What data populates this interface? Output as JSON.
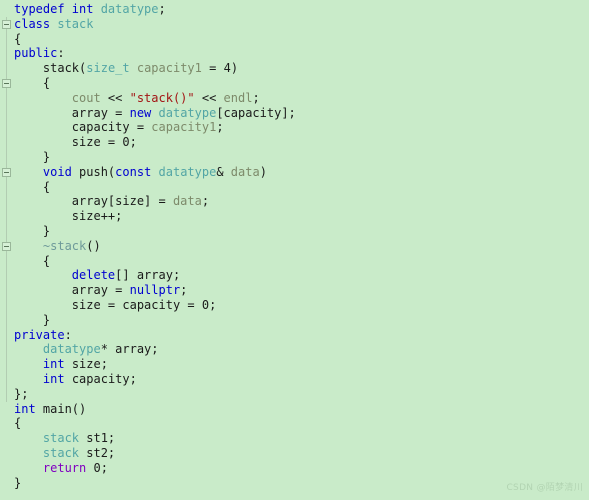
{
  "editor": {
    "background_color": "#c9ebc9",
    "language": "C++",
    "colors": {
      "keyword": "#0000d0",
      "type": "#52a5a5",
      "string": "#a31515",
      "variable": "#7d8a6a",
      "return_keyword": "#8000c0",
      "plain": "#1a1a1a",
      "destructor": "#6f9a9a",
      "gutter_rail": "#b2cdb2",
      "watermark": "#b2d4b2"
    }
  },
  "watermark": {
    "text": "CSDN @陌梦清川"
  },
  "gutter": {
    "fold_markers": [
      {
        "line": 2,
        "label": "fold-class-stack"
      },
      {
        "line": 6,
        "label": "fold-constructor"
      },
      {
        "line": 12,
        "label": "fold-push"
      },
      {
        "line": 17,
        "label": "fold-destructor"
      }
    ]
  },
  "code": {
    "lines": [
      {
        "n": 1,
        "text": "typedef int datatype;"
      },
      {
        "n": 2,
        "text": "class stack"
      },
      {
        "n": 3,
        "text": "{"
      },
      {
        "n": 4,
        "text": "public:"
      },
      {
        "n": 5,
        "text": "    stack(size_t capacity1 = 4)"
      },
      {
        "n": 6,
        "text": "    {"
      },
      {
        "n": 7,
        "text": "        cout << \"stack()\" << endl;"
      },
      {
        "n": 8,
        "text": "        array = new datatype[capacity];"
      },
      {
        "n": 9,
        "text": "        capacity = capacity1;"
      },
      {
        "n": 10,
        "text": "        size = 0;"
      },
      {
        "n": 11,
        "text": "    }"
      },
      {
        "n": 12,
        "text": "    void push(const datatype& data)"
      },
      {
        "n": 13,
        "text": "    {"
      },
      {
        "n": 14,
        "text": "        array[size] = data;"
      },
      {
        "n": 15,
        "text": "        size++;"
      },
      {
        "n": 16,
        "text": "    }"
      },
      {
        "n": 17,
        "text": "    ~stack()"
      },
      {
        "n": 18,
        "text": "    {"
      },
      {
        "n": 19,
        "text": "        delete[] array;"
      },
      {
        "n": 20,
        "text": "        array = nullptr;"
      },
      {
        "n": 21,
        "text": "        size = capacity = 0;"
      },
      {
        "n": 22,
        "text": "    }"
      },
      {
        "n": 23,
        "text": "private:"
      },
      {
        "n": 24,
        "text": "    datatype* array;"
      },
      {
        "n": 25,
        "text": "    int size;"
      },
      {
        "n": 26,
        "text": "    int capacity;"
      },
      {
        "n": 27,
        "text": "};"
      },
      {
        "n": 28,
        "text": "int main()"
      },
      {
        "n": 29,
        "text": "{"
      },
      {
        "n": 30,
        "text": "    stack st1;"
      },
      {
        "n": 31,
        "text": "    stack st2;"
      },
      {
        "n": 32,
        "text": "    return 0;"
      },
      {
        "n": 33,
        "text": "}"
      }
    ],
    "tokens": [
      [
        {
          "t": "typedef ",
          "c": "kw"
        },
        {
          "t": "int ",
          "c": "kw"
        },
        {
          "t": "datatype",
          "c": "typ"
        },
        {
          "t": ";",
          "c": "pun"
        }
      ],
      [
        {
          "t": "class ",
          "c": "kw"
        },
        {
          "t": "stack",
          "c": "typ"
        }
      ],
      [
        {
          "t": "{",
          "c": "pun"
        }
      ],
      [
        {
          "t": "public",
          "c": "kw"
        },
        {
          "t": ":",
          "c": "pun"
        }
      ],
      [
        {
          "t": "    stack",
          "c": "pun"
        },
        {
          "t": "(",
          "c": "pun"
        },
        {
          "t": "size_t",
          "c": "typ"
        },
        {
          "t": " ",
          "c": "pun"
        },
        {
          "t": "capacity1",
          "c": "var"
        },
        {
          "t": " = ",
          "c": "pun"
        },
        {
          "t": "4",
          "c": "pun"
        },
        {
          "t": ")",
          "c": "pun"
        }
      ],
      [
        {
          "t": "    {",
          "c": "pun"
        }
      ],
      [
        {
          "t": "        ",
          "c": "pun"
        },
        {
          "t": "cout",
          "c": "var"
        },
        {
          "t": " << ",
          "c": "pun"
        },
        {
          "t": "\"stack()\"",
          "c": "str"
        },
        {
          "t": " << ",
          "c": "pun"
        },
        {
          "t": "endl",
          "c": "var"
        },
        {
          "t": ";",
          "c": "pun"
        }
      ],
      [
        {
          "t": "        array = ",
          "c": "pun"
        },
        {
          "t": "new",
          "c": "kw"
        },
        {
          "t": " ",
          "c": "pun"
        },
        {
          "t": "datatype",
          "c": "typ"
        },
        {
          "t": "[capacity];",
          "c": "pun"
        }
      ],
      [
        {
          "t": "        capacity = ",
          "c": "pun"
        },
        {
          "t": "capacity1",
          "c": "var"
        },
        {
          "t": ";",
          "c": "pun"
        }
      ],
      [
        {
          "t": "        size = 0;",
          "c": "pun"
        }
      ],
      [
        {
          "t": "    }",
          "c": "pun"
        }
      ],
      [
        {
          "t": "    ",
          "c": "pun"
        },
        {
          "t": "void",
          "c": "kw"
        },
        {
          "t": " push(",
          "c": "pun"
        },
        {
          "t": "const",
          "c": "kw"
        },
        {
          "t": " ",
          "c": "pun"
        },
        {
          "t": "datatype",
          "c": "typ"
        },
        {
          "t": "& ",
          "c": "pun"
        },
        {
          "t": "data",
          "c": "var"
        },
        {
          "t": ")",
          "c": "pun"
        }
      ],
      [
        {
          "t": "    {",
          "c": "pun"
        }
      ],
      [
        {
          "t": "        array[size] = ",
          "c": "pun"
        },
        {
          "t": "data",
          "c": "var"
        },
        {
          "t": ";",
          "c": "pun"
        }
      ],
      [
        {
          "t": "        size++;",
          "c": "pun"
        }
      ],
      [
        {
          "t": "    }",
          "c": "pun"
        }
      ],
      [
        {
          "t": "    ",
          "c": "pun"
        },
        {
          "t": "~stack",
          "c": "dtor"
        },
        {
          "t": "()",
          "c": "pun"
        }
      ],
      [
        {
          "t": "    {",
          "c": "pun"
        }
      ],
      [
        {
          "t": "        ",
          "c": "pun"
        },
        {
          "t": "delete",
          "c": "kw"
        },
        {
          "t": "[] array;",
          "c": "pun"
        }
      ],
      [
        {
          "t": "        array = ",
          "c": "pun"
        },
        {
          "t": "nullptr",
          "c": "kw"
        },
        {
          "t": ";",
          "c": "pun"
        }
      ],
      [
        {
          "t": "        size = capacity = 0;",
          "c": "pun"
        }
      ],
      [
        {
          "t": "    }",
          "c": "pun"
        }
      ],
      [
        {
          "t": "private",
          "c": "kw"
        },
        {
          "t": ":",
          "c": "pun"
        }
      ],
      [
        {
          "t": "    ",
          "c": "pun"
        },
        {
          "t": "datatype",
          "c": "typ"
        },
        {
          "t": "* array;",
          "c": "pun"
        }
      ],
      [
        {
          "t": "    ",
          "c": "pun"
        },
        {
          "t": "int",
          "c": "kw"
        },
        {
          "t": " size;",
          "c": "pun"
        }
      ],
      [
        {
          "t": "    ",
          "c": "pun"
        },
        {
          "t": "int",
          "c": "kw"
        },
        {
          "t": " capacity;",
          "c": "pun"
        }
      ],
      [
        {
          "t": "};",
          "c": "pun"
        }
      ],
      [
        {
          "t": "int",
          "c": "kw"
        },
        {
          "t": " main()",
          "c": "pun"
        }
      ],
      [
        {
          "t": "{",
          "c": "pun"
        }
      ],
      [
        {
          "t": "    ",
          "c": "pun"
        },
        {
          "t": "stack",
          "c": "typ"
        },
        {
          "t": " st1;",
          "c": "pun"
        }
      ],
      [
        {
          "t": "    ",
          "c": "pun"
        },
        {
          "t": "stack",
          "c": "typ"
        },
        {
          "t": " st2;",
          "c": "pun"
        }
      ],
      [
        {
          "t": "    ",
          "c": "pun"
        },
        {
          "t": "return",
          "c": "ret"
        },
        {
          "t": " 0;",
          "c": "pun"
        }
      ],
      [
        {
          "t": "}",
          "c": "pun"
        }
      ]
    ]
  }
}
